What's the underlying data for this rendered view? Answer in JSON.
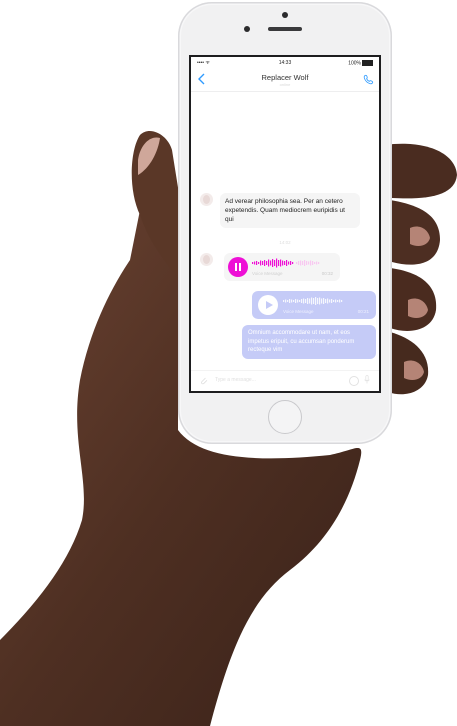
{
  "status_bar": {
    "signal": "•••• ᯤ",
    "time": "14:33",
    "battery": "100%"
  },
  "chat": {
    "contact_name": "Replacer Wolf",
    "contact_status": "online",
    "messages": [
      {
        "direction": "in",
        "type": "text",
        "text": "Ad verear philosophia sea. Per an cetero expetendis. Quam mediocrem euripidis ut qui"
      },
      {
        "direction": "in",
        "type": "voice",
        "label": "Voice Message",
        "duration": "00:32",
        "state": "playing"
      },
      {
        "direction": "out",
        "type": "voice",
        "label": "Voice Message",
        "duration": "00:21",
        "state": "paused"
      },
      {
        "direction": "out",
        "type": "text",
        "text": "Omnium accommodare ut nam, et eos impetus eripuit, cu accumsan ponderum recteque vim"
      }
    ],
    "date_separator": "14:02",
    "input_placeholder": "Type a message..."
  },
  "colors": {
    "accent_pink": "#ee10d6",
    "outgoing_bubble": "#c5cbf7",
    "incoming_bubble": "#f5f5f5",
    "ios_blue": "#2f9bff"
  },
  "icons": [
    "back-chevron-icon",
    "phone-call-icon",
    "pause-icon",
    "play-icon",
    "attach-icon",
    "emoji-icon",
    "mic-icon",
    "avatar-icon"
  ]
}
